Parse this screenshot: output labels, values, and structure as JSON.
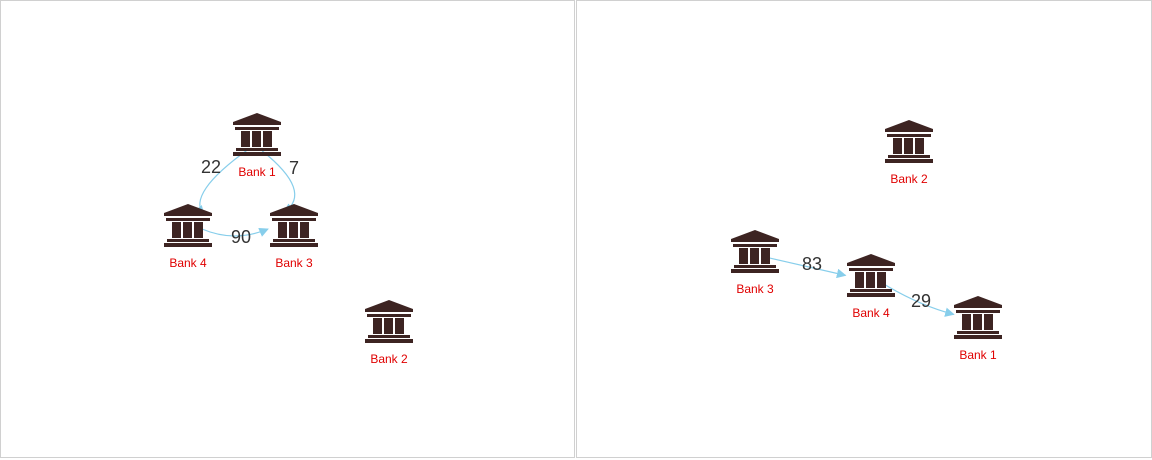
{
  "colors": {
    "icon": "#3d2422",
    "label": "#e00000",
    "edge": "#87ceeb",
    "edge_label": "#333333"
  },
  "panels": [
    {
      "nodes": [
        {
          "id": "b1",
          "label": "Bank 1",
          "icon": "bank-icon"
        },
        {
          "id": "b4",
          "label": "Bank 4",
          "icon": "bank-icon"
        },
        {
          "id": "b3",
          "label": "Bank 3",
          "icon": "bank-icon"
        },
        {
          "id": "b2",
          "label": "Bank 2",
          "icon": "bank-icon"
        }
      ],
      "edges": [
        {
          "from": "b1",
          "to": "b4",
          "label": "22"
        },
        {
          "from": "b1",
          "to": "b3",
          "label": "7"
        },
        {
          "from": "b4",
          "to": "b3",
          "label": "90"
        }
      ]
    },
    {
      "nodes": [
        {
          "id": "b2",
          "label": "Bank 2",
          "icon": "bank-icon"
        },
        {
          "id": "b3",
          "label": "Bank 3",
          "icon": "bank-icon"
        },
        {
          "id": "b4",
          "label": "Bank 4",
          "icon": "bank-icon"
        },
        {
          "id": "b1",
          "label": "Bank 1",
          "icon": "bank-icon"
        }
      ],
      "edges": [
        {
          "from": "b3",
          "to": "b4",
          "label": "83"
        },
        {
          "from": "b4",
          "to": "b1",
          "label": "29"
        }
      ]
    }
  ]
}
